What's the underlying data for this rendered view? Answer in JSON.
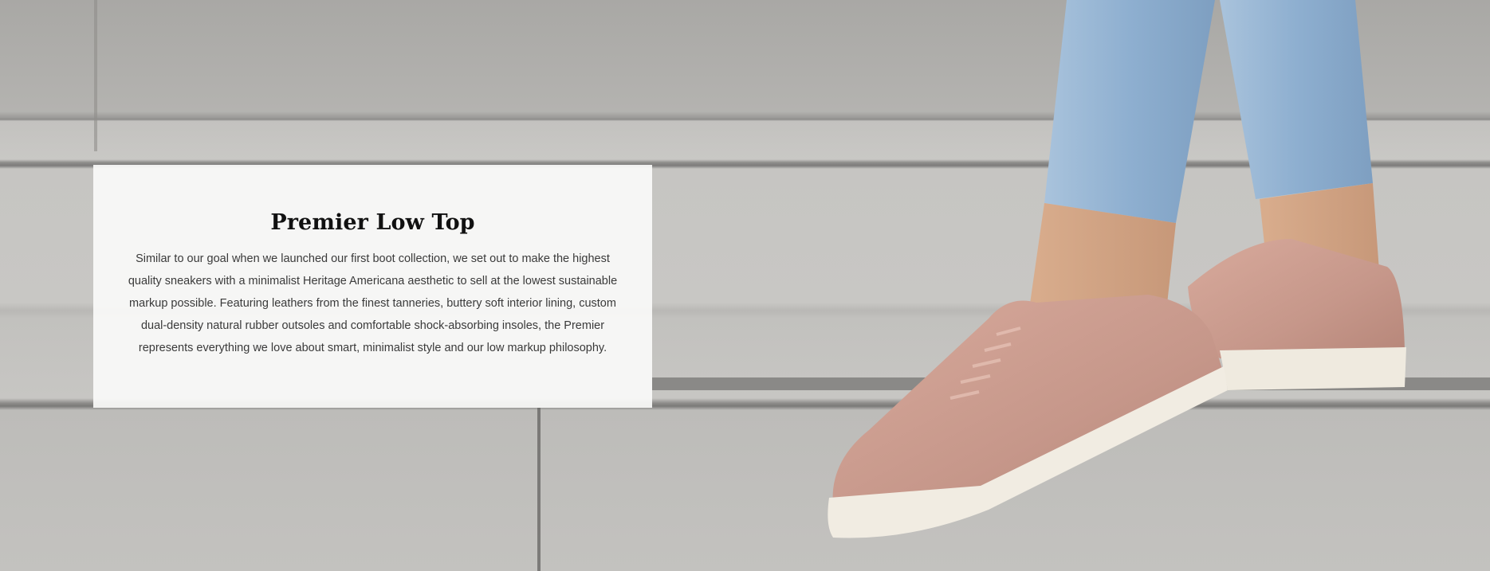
{
  "hero": {
    "image_alt": "Person walking down concrete steps wearing pink leather low top sneakers and light blue jeans",
    "colors": {
      "concrete": "#c3c2bf",
      "concrete_shadow": "#7d7c7b",
      "denim": "#8fb0cf",
      "leather": "#c99a8e",
      "sole": "#f1ece2",
      "card_bg": "#fafaf9"
    }
  },
  "card": {
    "title": "Premier Low Top",
    "body": "Similar to our goal when we launched our first boot collection, we set out to make the highest quality sneakers with a minimalist Heritage Americana aesthetic to sell at the lowest sustainable markup possible. Featuring leathers from the finest tanneries, buttery soft interior lining, custom dual-density natural rubber outsoles and comfortable shock-absorbing insoles, the Premier represents everything we love about smart, minimalist style and our low markup philosophy."
  }
}
